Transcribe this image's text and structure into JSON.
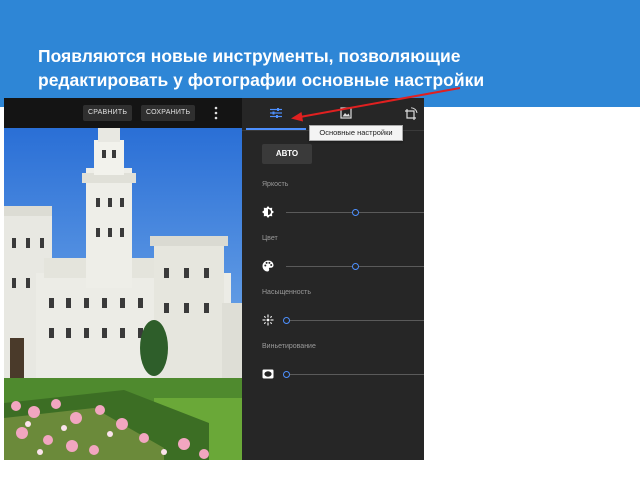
{
  "banner": {
    "title_line1": "Появляются новые инструменты, позволяющие",
    "title_line2": "редактировать у фотографии основные настройки"
  },
  "toolbar": {
    "compare_label": "СРАВНИТЬ",
    "save_label": "СОХРАНИТЬ",
    "more_icon": "more-vert-icon"
  },
  "panel": {
    "tabs": [
      {
        "icon": "tune-icon",
        "active": true
      },
      {
        "icon": "image-filter-icon",
        "active": false
      },
      {
        "icon": "crop-rotate-icon",
        "active": false
      }
    ],
    "tooltip": "Основные настройки",
    "auto_label": "АВТО",
    "controls": [
      {
        "label": "Яркость",
        "icon": "brightness-icon",
        "value": 0.5
      },
      {
        "label": "Цвет",
        "icon": "palette-icon",
        "value": 0.5
      },
      {
        "label": "Насыщенность",
        "icon": "saturation-icon",
        "value": 0.0
      },
      {
        "label": "Виньетирование",
        "icon": "vignette-icon",
        "value": 0.0
      }
    ]
  },
  "colors": {
    "banner": "#2e86d6",
    "accent": "#4d90fe",
    "arrow": "#e02020",
    "panel_bg": "#262626"
  }
}
